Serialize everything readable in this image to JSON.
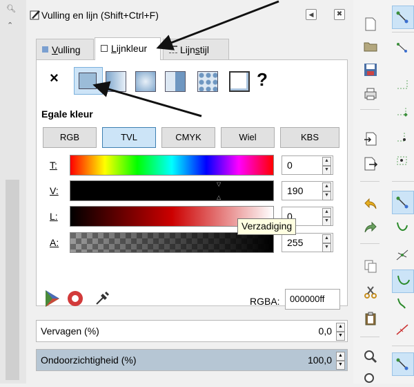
{
  "dialog": {
    "title": "Vulling en lijn (Shift+Ctrl+F)",
    "tabs": [
      {
        "label": "Vulling",
        "underline": "V",
        "rest": "ulling"
      },
      {
        "label": "Lijnkleur",
        "underline": "L",
        "rest": "ijnkleur"
      },
      {
        "label": "Lijnstijl",
        "pre": "Lijn",
        "underline": "s",
        "rest": "tijl"
      }
    ],
    "paint_none": "×",
    "paint_unset": "?",
    "flat_color_label": "Egale kleur",
    "modes": [
      "RGB",
      "TVL",
      "CMYK",
      "Wiel",
      "KBS"
    ],
    "active_mode": "TVL",
    "sliders": [
      {
        "label": "T:",
        "value": "0"
      },
      {
        "label": "V:",
        "value": "190"
      },
      {
        "label": "L:",
        "value": "0"
      },
      {
        "label": "A:",
        "value": "255"
      }
    ],
    "tooltip": "Verzadiging",
    "rgba_label": "RGBA:",
    "rgba_value": "000000ff",
    "blur_label": "Vervagen (%)",
    "blur_value": "0,0",
    "opacity_label": "Ondoorzichtigheid (%)",
    "opacity_value": "100,0"
  },
  "colors": {
    "accent": "#cce4f7",
    "accent_border": "#3c7fb1",
    "flat_swatch": "#9bbcd8"
  }
}
